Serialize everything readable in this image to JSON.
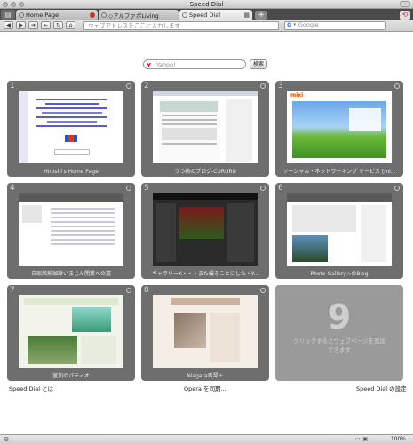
{
  "window": {
    "title": "Speed Dial"
  },
  "tabs": [
    {
      "label": "Home Page"
    },
    {
      "label": "◇アルファポLiving"
    },
    {
      "label": "Speed Dial"
    }
  ],
  "toolbar": {
    "address_placeholder": "ウェブアドレスをここに入力します",
    "search_engine": "Google",
    "search_placeholder": "Google"
  },
  "yahoo_search": {
    "placeholder": "Yahoo!",
    "button": "検索"
  },
  "dials": [
    {
      "number": "1",
      "caption": "Hiroshi's Home Page"
    },
    {
      "number": "2",
      "caption": "うつ病のブログ-CURURU"
    },
    {
      "number": "3",
      "caption": "ソーシャル・ネットワーキング サービス [mi..."
    },
    {
      "number": "4",
      "caption": "自家焙煎珈琲いまじん開業への道"
    },
    {
      "number": "5",
      "caption": "ギャラリーK・・・また撮ることにした・Y..."
    },
    {
      "number": "6",
      "caption": "Photo Gallery☆のBlog"
    },
    {
      "number": "7",
      "caption": "室加のパティオ"
    },
    {
      "number": "8",
      "caption": "Niagara風琴＋"
    }
  ],
  "empty_dial": {
    "number": "9",
    "message": "クリックするとウェブページを追加できます"
  },
  "footer": {
    "left": "Speed Dial とは",
    "center": "Opera を同期...",
    "right": "Speed Dial の設定"
  },
  "status": {
    "zoom": "100%"
  }
}
